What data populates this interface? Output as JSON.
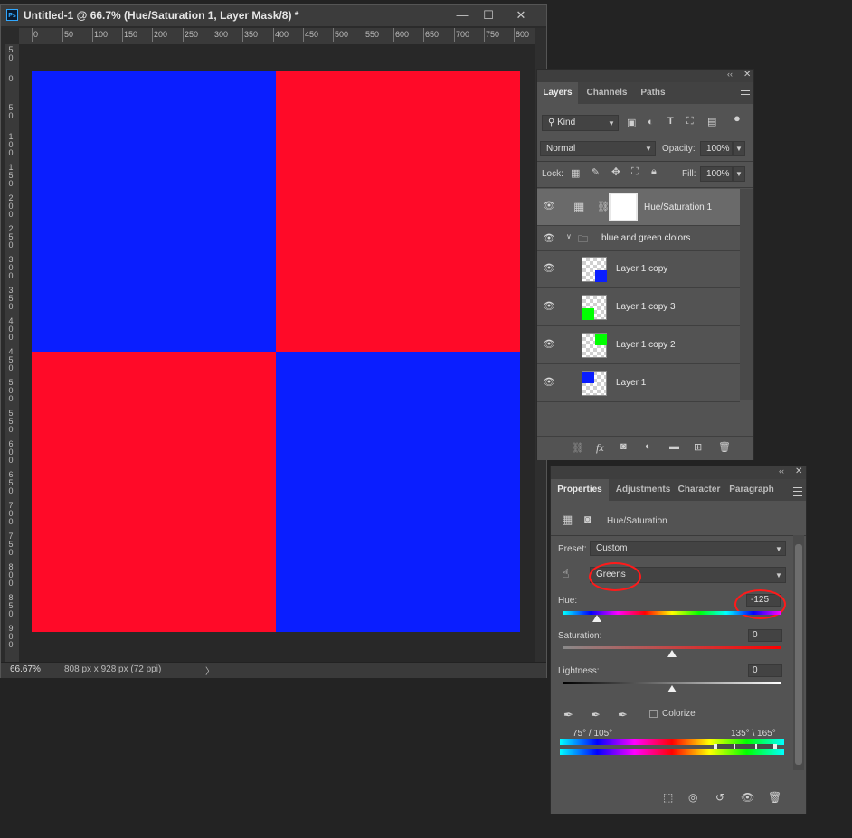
{
  "document": {
    "title": "Untitled-1 @ 66.7% (Hue/Saturation 1, Layer Mask/8) *",
    "app_icon": "Ps",
    "minimize": "—",
    "maximize": "☐",
    "close": "✕",
    "ruler_h": [
      "0",
      "50",
      "100",
      "150",
      "200",
      "250",
      "300",
      "350",
      "400",
      "450",
      "500",
      "550",
      "600",
      "650",
      "700",
      "750",
      "800"
    ],
    "ruler_v": [
      "50",
      "0",
      "50",
      "100",
      "150",
      "200",
      "250",
      "300",
      "350",
      "400",
      "450",
      "500",
      "550",
      "600",
      "650",
      "700",
      "750",
      "800",
      "850",
      "900"
    ],
    "zoom": "66.67%",
    "doc_size": "808 px x 928 px (72 ppi)",
    "status_arrow": "〉",
    "canvas_colors": {
      "top_left": "#0a1eff",
      "top_right": "#ff0a28",
      "bottom_left": "#ff0a28",
      "bottom_right": "#0a1eff"
    }
  },
  "layers_panel": {
    "collapse": "‹‹",
    "close": "✕",
    "tabs": [
      {
        "label": "Layers"
      },
      {
        "label": "Channels"
      },
      {
        "label": "Paths"
      }
    ],
    "filter_kind": "Kind",
    "blend_mode": "Normal",
    "opacity_label": "Opacity:",
    "opacity_value": "100%",
    "lock_label": "Lock:",
    "fill_label": "Fill:",
    "fill_value": "100%",
    "layers": [
      {
        "name": "Hue/Saturation 1"
      },
      {
        "name": "blue and green clolors"
      },
      {
        "name": "Layer 1 copy"
      },
      {
        "name": "Layer 1 copy 3"
      },
      {
        "name": "Layer 1 copy 2"
      },
      {
        "name": "Layer 1"
      }
    ],
    "thumb_colors": {
      "blue": "#0a1eff",
      "green": "#00ff00"
    }
  },
  "properties_panel": {
    "collapse": "‹‹",
    "close": "✕",
    "tabs": [
      {
        "label": "Properties"
      },
      {
        "label": "Adjustments"
      },
      {
        "label": "Character"
      },
      {
        "label": "Paragraph"
      }
    ],
    "adjustment_title": "Hue/Saturation",
    "preset_label": "Preset:",
    "preset_value": "Custom",
    "channel_value": "Greens",
    "hue_label": "Hue:",
    "hue_value": "-125",
    "saturation_label": "Saturation:",
    "saturation_value": "0",
    "lightness_label": "Lightness:",
    "lightness_value": "0",
    "colorize_label": "Colorize",
    "range_left": "75° /  105°",
    "range_right": "135° \\  165°",
    "annotation_color": "#ff1a1a"
  }
}
